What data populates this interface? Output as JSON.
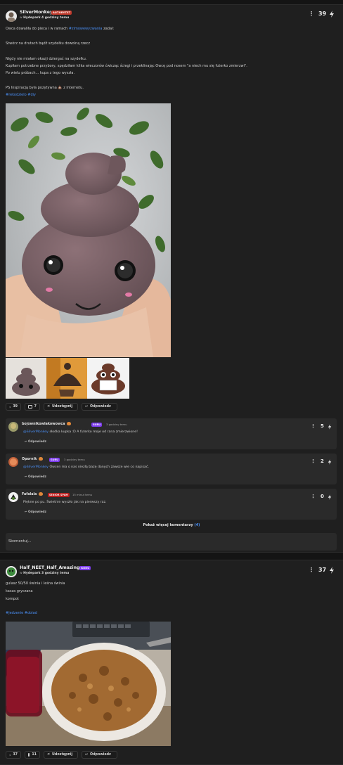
{
  "post1": {
    "author": "SilverMonkey",
    "rank": "AUTORYTET",
    "meta_prefix": "w",
    "community": "Hydepark",
    "time": "4 godziny temu",
    "score": "39",
    "lines": {
      "l1a": "Owca dowaliła do pieca i w ramach ",
      "l1tag": "#zimowewyzwania",
      "l1b": " zadał:",
      "l2": "Stwórz na drutach bądź szydełku dowolną rzecz",
      "l3": "Nigdy nie miałam okazji dziergać na szydełku.",
      "l4": "Kupiłam potrzebne przybory, spędziłam kilka wieczorów ćwicząc ściegi i przeklinając Owcę pod nosem \"a niech mu się futerko zmierzwi\".",
      "l5": "Po wielu próbach... kupa z tego wyszła.",
      "l6a": "PS Inspiracją była pozytywna",
      "l6b": " z internetu.",
      "tag1": "#rekodzielo",
      "tag2": "#diy"
    },
    "actions": {
      "score": "39",
      "comments": "7",
      "share": "Udostępnij",
      "reply": "Odpowiedz"
    },
    "comments": [
      {
        "author": "bojownikowlakowowca",
        "rank": "GURU",
        "time": "3 godziny temu",
        "mention": "@SilverMonkey",
        "text": " słodka kupka :D A futerko moje od rana zmierzwione!",
        "reply": "Odpowiedz",
        "score": "5"
      },
      {
        "author": "Opornik",
        "rank": "GURU",
        "time": "3 godziny temu",
        "mention": "@SilverMonkey",
        "text": " Owcen ma o nas niezłą bazę danych zawsze wie co napisać.",
        "reply": "Odpowiedz",
        "score": "2"
      },
      {
        "author": "Fafalala",
        "rank": "SENIOR SPAM",
        "time": "15 minut temu",
        "mention": "",
        "text": "Piękne po pu. Świetnie wyszło jak na pierwszy raz.",
        "reply": "Odpowiedz",
        "score": "0"
      }
    ],
    "more_label": "Pokaż więcej komentarzy",
    "more_count": "(4)",
    "comment_placeholder": "Skomentuj..."
  },
  "post2": {
    "author": "Half_NEET_Half_Amazing",
    "rank": "GURU",
    "meta_prefix": "w",
    "community": "Hydepark",
    "time": "3 godziny temu",
    "score": "37",
    "lines": {
      "l1": "gulasz 50/50 świnia i leśna świnia",
      "l2": "kasza gryczana",
      "l3": "kompot",
      "tag1": "#jedzenie",
      "tag2": "#obiad"
    },
    "actions": {
      "score": "37",
      "comments": "11",
      "share": "Udostępnij",
      "reply": "Odpowiedz"
    }
  },
  "colors": {
    "accent": "#4a8ff5",
    "rank_autorytet": "#c0392b",
    "rank_guru": "#7c3aed",
    "rank_senior": "#b91c1c"
  }
}
